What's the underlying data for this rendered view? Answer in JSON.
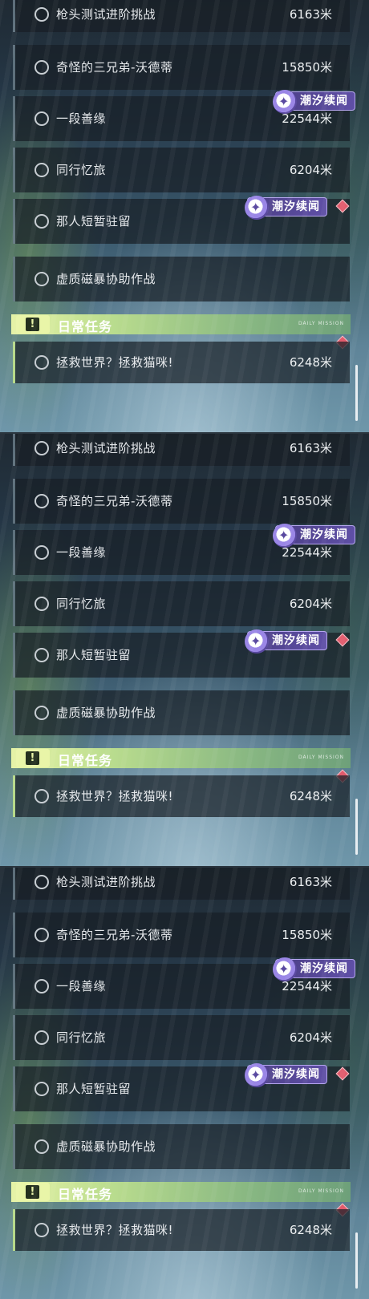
{
  "quests": [
    {
      "title": "枪头测试进阶挑战",
      "distance": "6163米"
    },
    {
      "title": "奇怪的三兄弟-沃德蒂",
      "distance": "15850米"
    },
    {
      "title": "一段善缘",
      "distance": "22544米"
    },
    {
      "title": "同行忆旅",
      "distance": "6204米"
    },
    {
      "title": "那人短暂驻留",
      "distance": ""
    },
    {
      "title": "虚质磁暴协助作战",
      "distance": ""
    }
  ],
  "badge_label": "潮汐续闻",
  "daily": {
    "section_title": "日常任务",
    "section_tag": "DAILY MISSION",
    "alert_icon": "!",
    "quest_title": "拯救世界？拯救猫咪!",
    "quest_distance": "6248米"
  },
  "colors": {
    "badge": "#5f4fa6",
    "daily_accent": "#b9dc8e",
    "marker": "#e25b6c"
  }
}
